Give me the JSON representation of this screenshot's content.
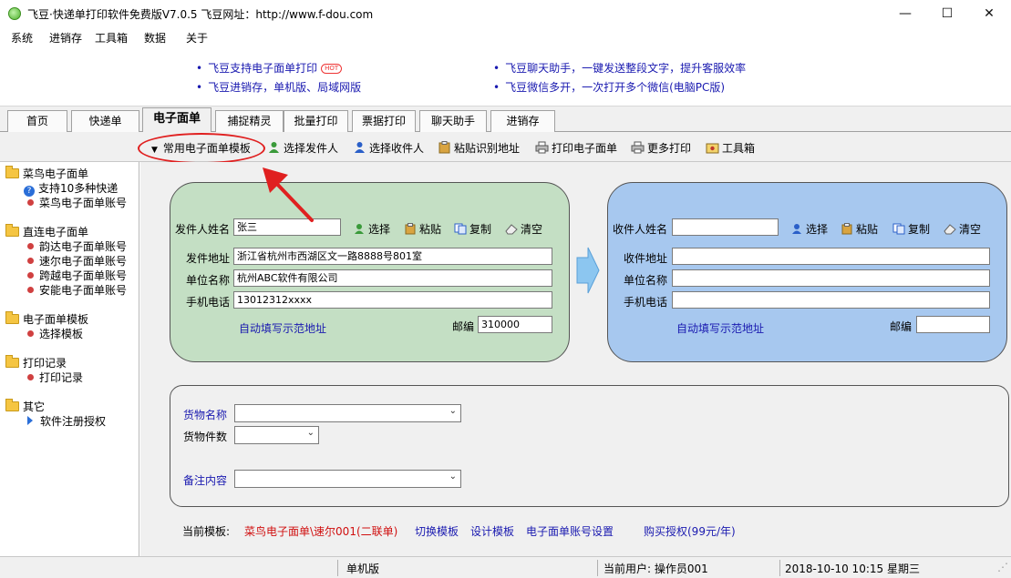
{
  "window": {
    "title": "飞豆·快递单打印软件免费版V7.0.5   飞豆网址：http://www.f-dou.com",
    "minimize": "—",
    "maximize": "☐",
    "close": "✕"
  },
  "menu": [
    "系统",
    "进销存",
    "工具箱",
    "数据",
    "关于"
  ],
  "ads": {
    "left": [
      "飞豆支持电子面单打印",
      "飞豆进销存，单机版、局域网版"
    ],
    "hot_badge": "HOT",
    "right": [
      "飞豆聊天助手，一键发送整段文字，提升客服效率",
      "飞豆微信多开，一次打开多个微信(电脑PC版)"
    ]
  },
  "tabs": [
    "首页",
    "快递单",
    "电子面单",
    "捕捉精灵",
    "批量打印",
    "票据打印",
    "聊天助手",
    "进销存"
  ],
  "active_tab": "电子面单",
  "toolbar": {
    "template_dropdown": "常用电子面单模板",
    "select_sender": "选择发件人",
    "select_receiver": "选择收件人",
    "paste_recognize": "粘贴识别地址",
    "print_waybill": "打印电子面单",
    "more_print": "更多打印",
    "toolbox": "工具箱"
  },
  "tree": {
    "groups": [
      {
        "label": "菜鸟电子面单",
        "items": [
          {
            "label": "支持10多种快递",
            "icon": "help-icon"
          },
          {
            "label": "菜鸟电子面单账号",
            "icon": "dot"
          }
        ]
      },
      {
        "label": "直连电子面单",
        "items": [
          {
            "label": "韵达电子面单账号",
            "icon": "dot"
          },
          {
            "label": "速尔电子面单账号",
            "icon": "dot"
          },
          {
            "label": "跨越电子面单账号",
            "icon": "dot"
          },
          {
            "label": "安能电子面单账号",
            "icon": "dot"
          }
        ]
      },
      {
        "label": "电子面单模板",
        "items": [
          {
            "label": "选择模板",
            "icon": "dot"
          }
        ]
      },
      {
        "label": "打印记录",
        "items": [
          {
            "label": "打印记录",
            "icon": "dot"
          }
        ]
      },
      {
        "label": "其它",
        "items": [
          {
            "label": "软件注册授权",
            "icon": "triangle"
          }
        ]
      }
    ]
  },
  "sender": {
    "name_label": "发件人姓名",
    "name_value": "张三",
    "select": "选择",
    "paste": "粘贴",
    "copy": "复制",
    "clear": "清空",
    "address_label": "发件地址",
    "address_value": "浙江省杭州市西湖区文一路8888号801室",
    "company_label": "单位名称",
    "company_value": "杭州ABC软件有限公司",
    "phone_label": "手机电话",
    "phone_value": "13012312xxxx",
    "autofill": "自动填写示范地址",
    "zip_label": "邮编",
    "zip_value": "310000"
  },
  "receiver": {
    "name_label": "收件人姓名",
    "name_value": "",
    "select": "选择",
    "paste": "粘贴",
    "copy": "复制",
    "clear": "清空",
    "address_label": "收件地址",
    "address_value": "",
    "company_label": "单位名称",
    "company_value": "",
    "phone_label": "手机电话",
    "phone_value": "",
    "autofill": "自动填写示范地址",
    "zip_label": "邮编",
    "zip_value": ""
  },
  "goods": {
    "name_label": "货物名称",
    "name_value": "",
    "count_label": "货物件数",
    "count_value": "",
    "remark_label": "备注内容",
    "remark_value": ""
  },
  "footer_links": {
    "current_template_label": "当前模板:",
    "current_template_value": "菜鸟电子面单\\速尔001(二联单)",
    "switch_template": "切换模板",
    "design_template": "设计模板",
    "account_settings": "电子面单账号设置",
    "buy_license": "购买授权(99元/年)"
  },
  "status": {
    "mode": "单机版",
    "user": "当前用户: 操作员001",
    "datetime": "2018-10-10  10:15  星期三"
  },
  "colors": {
    "sender_panel": "#c4dfc4",
    "receiver_panel": "#a7c8ef",
    "link_blue": "#1a1ab0",
    "accent_red": "#e02020"
  }
}
